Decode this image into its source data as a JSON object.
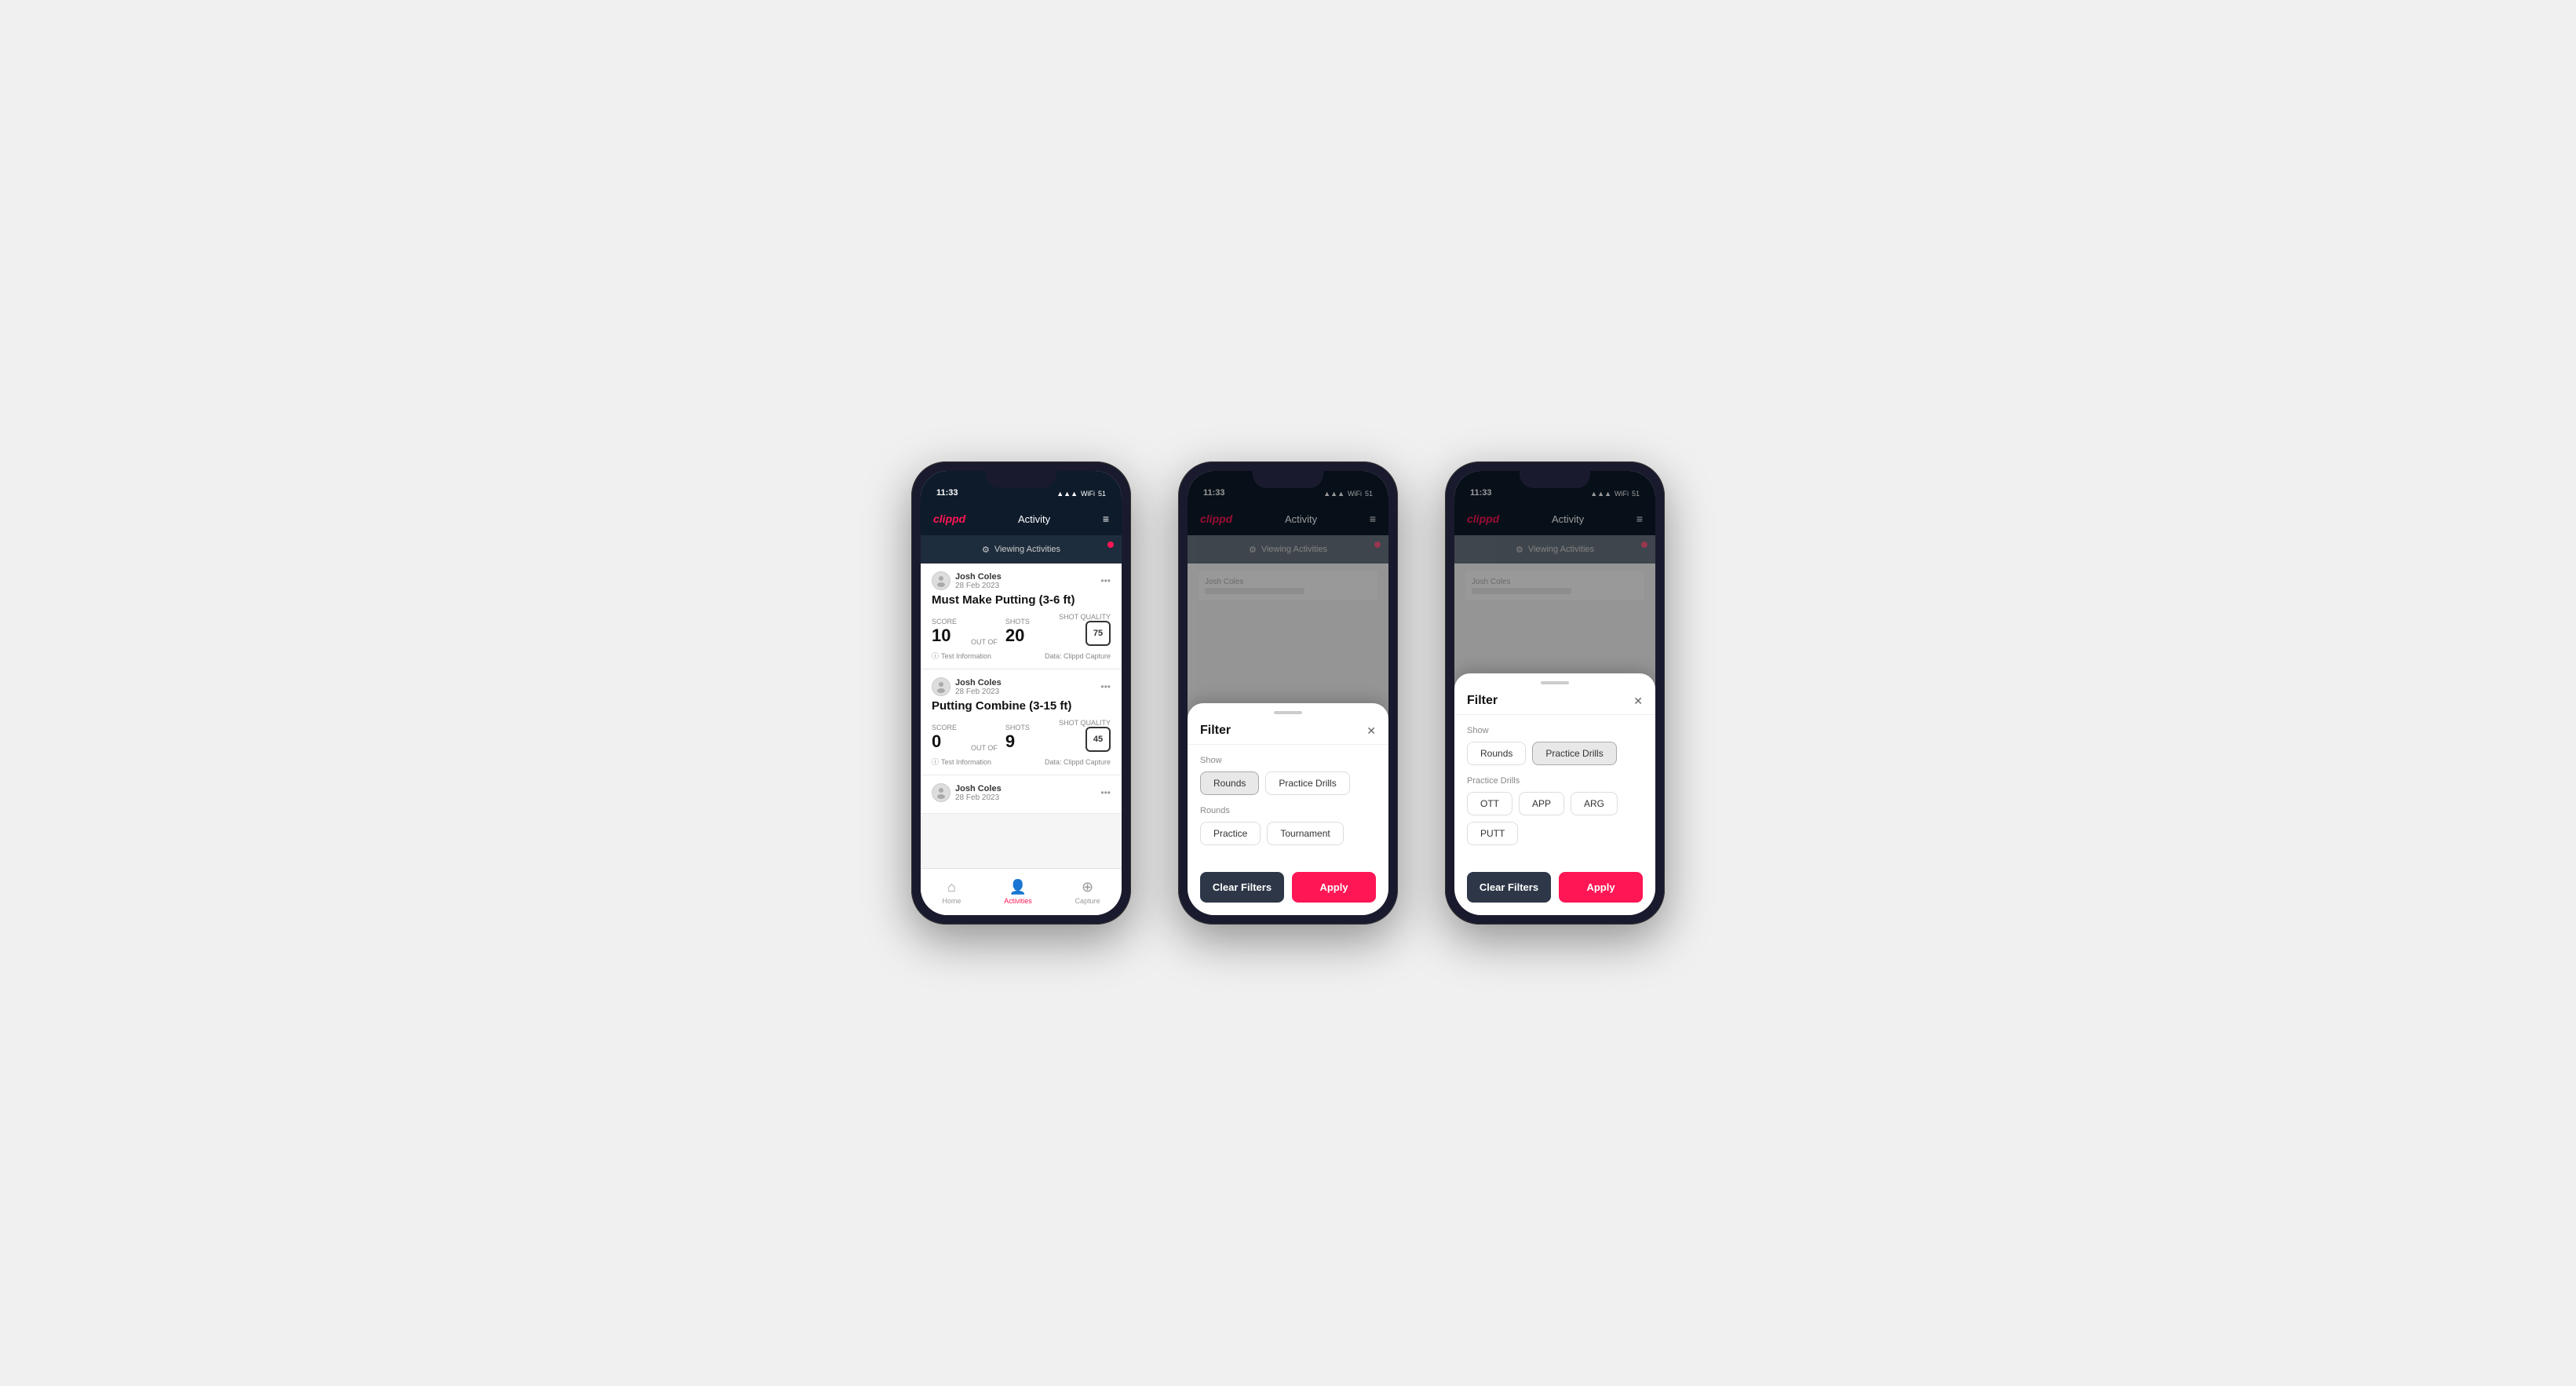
{
  "app": {
    "logo": "clippd",
    "header_title": "Activity",
    "time": "11:33",
    "menu_icon": "≡"
  },
  "viewing_bar": {
    "icon": "⚙",
    "label": "Viewing Activities"
  },
  "cards": [
    {
      "user_name": "Josh Coles",
      "user_date": "28 Feb 2023",
      "title": "Must Make Putting (3-6 ft)",
      "score_label": "Score",
      "score": "10",
      "out_of_label": "OUT OF",
      "shots_label": "Shots",
      "shots": "20",
      "quality_label": "Shot Quality",
      "quality": "75",
      "footer_left": "Test Information",
      "footer_right": "Data: Clippd Capture"
    },
    {
      "user_name": "Josh Coles",
      "user_date": "28 Feb 2023",
      "title": "Putting Combine (3-15 ft)",
      "score_label": "Score",
      "score": "0",
      "out_of_label": "OUT OF",
      "shots_label": "Shots",
      "shots": "9",
      "quality_label": "Shot Quality",
      "quality": "45",
      "footer_left": "Test Information",
      "footer_right": "Data: Clippd Capture"
    },
    {
      "user_name": "Josh Coles",
      "user_date": "28 Feb 2023",
      "title": "",
      "score": "",
      "shots": ""
    }
  ],
  "nav": {
    "home_label": "Home",
    "activities_label": "Activities",
    "capture_label": "Capture"
  },
  "filter_phone2": {
    "title": "Filter",
    "show_label": "Show",
    "rounds_btn": "Rounds",
    "practice_drills_btn": "Practice Drills",
    "rounds_section_label": "Rounds",
    "practice_btn": "Practice",
    "tournament_btn": "Tournament",
    "clear_label": "Clear Filters",
    "apply_label": "Apply",
    "active_tab": "rounds"
  },
  "filter_phone3": {
    "title": "Filter",
    "show_label": "Show",
    "rounds_btn": "Rounds",
    "practice_drills_btn": "Practice Drills",
    "practice_drills_section_label": "Practice Drills",
    "ott_btn": "OTT",
    "app_btn": "APP",
    "arg_btn": "ARG",
    "putt_btn": "PUTT",
    "clear_label": "Clear Filters",
    "apply_label": "Apply",
    "active_tab": "practice_drills"
  }
}
